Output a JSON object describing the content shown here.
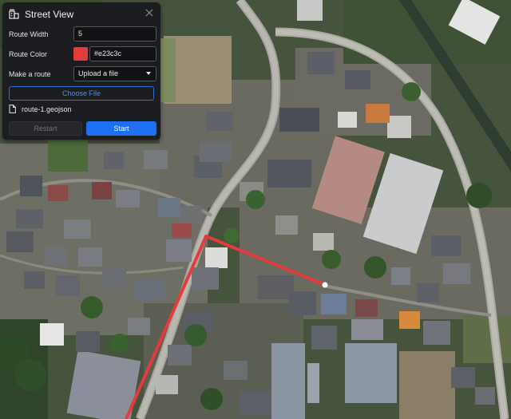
{
  "panel": {
    "title": "Street View",
    "fields": {
      "route_width_label": "Route Width",
      "route_width_value": "5",
      "route_color_label": "Route Color",
      "route_color_value": "#e23c3c",
      "make_route_label": "Make a route",
      "make_route_value": "Upload a file"
    },
    "choose_file_label": "Choose File",
    "file_name": "route-1.geojson",
    "restart_label": "Restart",
    "start_label": "Start"
  },
  "map": {
    "route_color": "#e23c3c"
  },
  "icons": {
    "title_icon": "building-icon",
    "close_icon": "close-icon",
    "file_icon": "file-icon"
  }
}
